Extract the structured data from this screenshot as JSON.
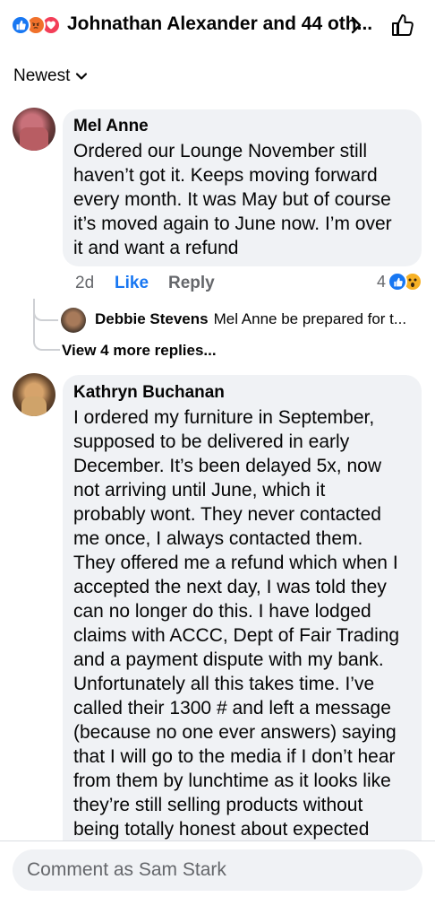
{
  "header": {
    "title": "Johnathan Alexander and 44 oth...",
    "reaction_icons": [
      "like-icon",
      "angry-icon",
      "love-icon"
    ]
  },
  "sort": {
    "label": "Newest"
  },
  "comments": [
    {
      "author": "Mel Anne",
      "text": "Ordered our Lounge November still\nhaven’t got it. Keeps moving forward\nevery month. It was May but of course\nit’s moved again to June now. I’m over\nit and want a refund",
      "time": "2d",
      "like_label": "Like",
      "reply_label": "Reply",
      "reaction_count": "4",
      "reaction_icons": [
        "like-icon",
        "wow-icon"
      ],
      "reply_preview": {
        "author": "Debbie Stevens",
        "text": "Mel Anne be prepared for t..."
      },
      "more_replies_label": "View 4 more replies..."
    },
    {
      "author": "Kathryn Buchanan",
      "text": "I ordered my furniture in September,\nsupposed to be delivered in early\nDecember. It’s been delayed 5x, now\nnot arriving until June, which it\nprobably wont. They never contacted\nme once, I always contacted them.\nThey offered me a refund which when I\naccepted the next day, I was told they\ncan no longer do this. I have lodged\nclaims with ACCC, Dept of Fair Trading\nand a payment dispute with my bank.\nUnfortunately all this takes time. I’ve\ncalled their 1300 # and left a message\n(because no one ever answers) saying\nthat I will go to the media if I don’t hear\nfrom them by lunchtime as it looks like\nthey’re still selling products without\nbeing totally honest about expected"
    }
  ],
  "composer": {
    "placeholder": "Comment as Sam Stark",
    "value": ""
  },
  "colors": {
    "accent": "#1877f2",
    "bubble": "#f0f2f5",
    "secondary_text": "#65676b",
    "angry": "#f0712b",
    "love": "#f33e58",
    "wow": "#f7b125"
  }
}
